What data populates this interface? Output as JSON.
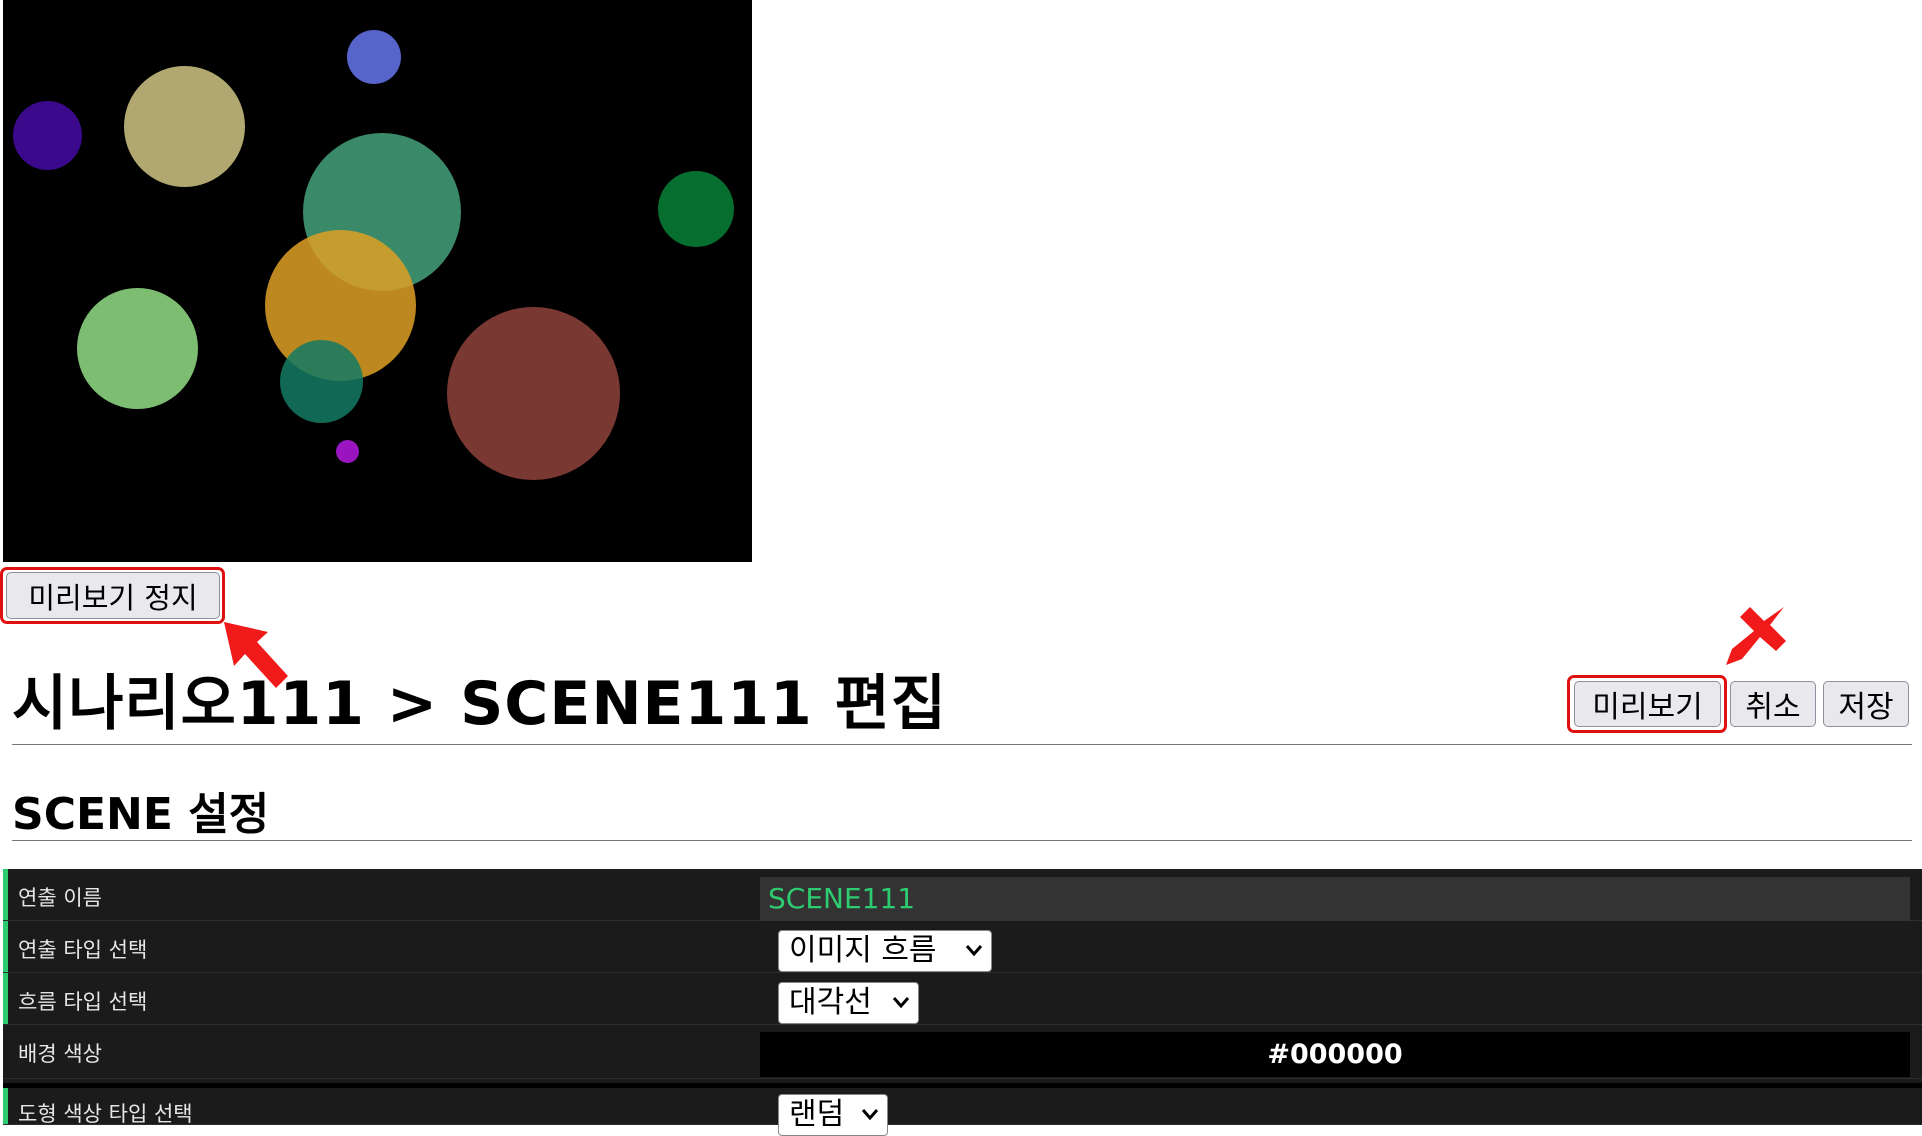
{
  "preview": {
    "background": "#000000",
    "shapes_colors": [
      "#5764c9",
      "#3b0a8c",
      "#b0a870",
      "#3a8a6a",
      "#066e2e",
      "#c89020",
      "#7cbd72",
      "#1e7866",
      "#7a3832",
      "#9a14c0"
    ]
  },
  "stop_preview_button": "미리보기 정지",
  "page_title": "시나리오111 > SCENE111 편집",
  "actions": {
    "preview": "미리보기",
    "cancel": "취소",
    "save": "저장"
  },
  "section_title": "SCENE 설정",
  "settings": {
    "direction_name": {
      "label": "연출 이름",
      "value": "SCENE111"
    },
    "direction_type": {
      "label": "연출 타입 선택",
      "selected": "이미지 흐름"
    },
    "flow_type": {
      "label": "흐름 타입 선택",
      "selected": "대각선"
    },
    "background_color": {
      "label": "배경 색상",
      "value": "#000000"
    },
    "shape_color_type": {
      "label": "도형 색상 타입 선택",
      "selected": "랜덤"
    }
  },
  "colors": {
    "accent": "#2ecc71",
    "highlight": "#e01010"
  }
}
